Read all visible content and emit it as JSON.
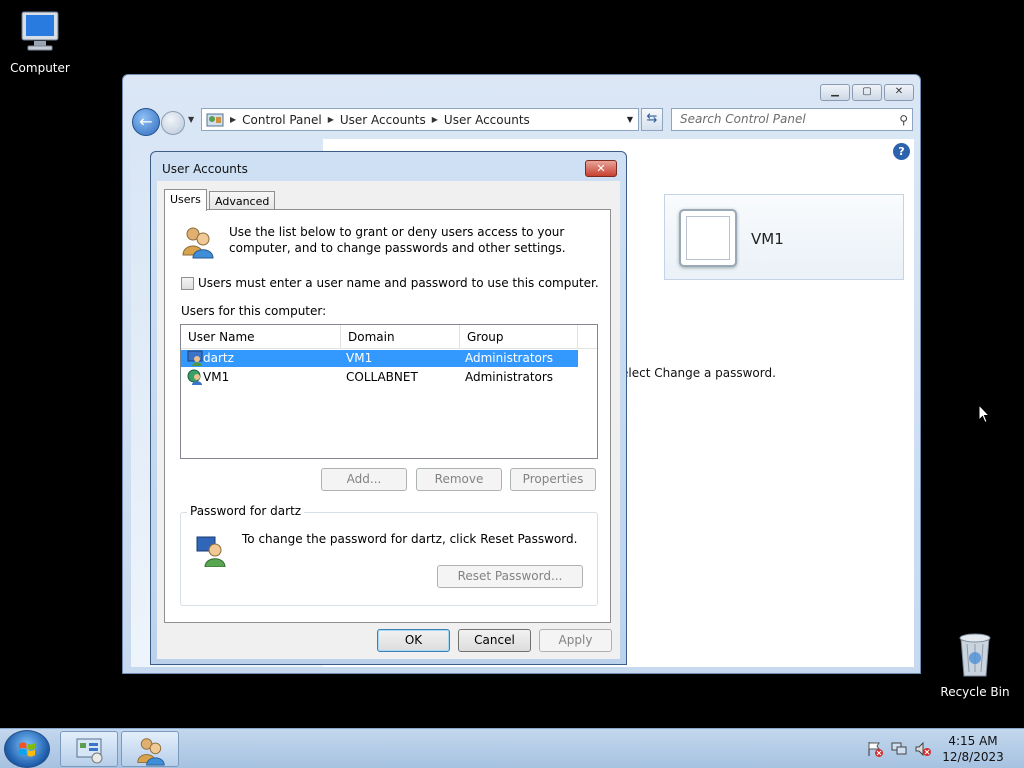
{
  "desktop": {
    "computer_label": "Computer",
    "recycle_label": "Recycle Bin"
  },
  "cp_window": {
    "address": [
      "Control Panel",
      "User Accounts",
      "User Accounts"
    ],
    "search_placeholder": "Search Control Panel",
    "user_tile_name": "VM1",
    "partial_text": "elect Change a password."
  },
  "dialog": {
    "title": "User Accounts",
    "close_label": "✕",
    "tabs": [
      "Users",
      "Advanced"
    ],
    "intro": "Use the list below to grant or deny users access to your computer, and to change passwords and other settings.",
    "checkbox_label": "Users must enter a user name and password to use this computer.",
    "checkbox_checked": false,
    "users_label": "Users for this computer:",
    "columns": [
      "User Name",
      "Domain",
      "Group"
    ],
    "rows": [
      {
        "user": "dartz",
        "domain": "VM1",
        "group": "Administrators",
        "selected": true
      },
      {
        "user": "VM1",
        "domain": "COLLABNET",
        "group": "Administrators",
        "selected": false
      }
    ],
    "buttons": {
      "add": "Add...",
      "remove": "Remove",
      "properties": "Properties",
      "reset_password": "Reset Password...",
      "ok": "OK",
      "cancel": "Cancel",
      "apply": "Apply"
    },
    "password_group_label": "Password for dartz",
    "password_text": "To change the password for dartz, click Reset Password."
  },
  "taskbar": {
    "time": "4:15 AM",
    "date": "12/8/2023"
  },
  "colors": {
    "selection": "#3399ff",
    "desktop": "#000000",
    "taskbar": "#b7cfea"
  }
}
